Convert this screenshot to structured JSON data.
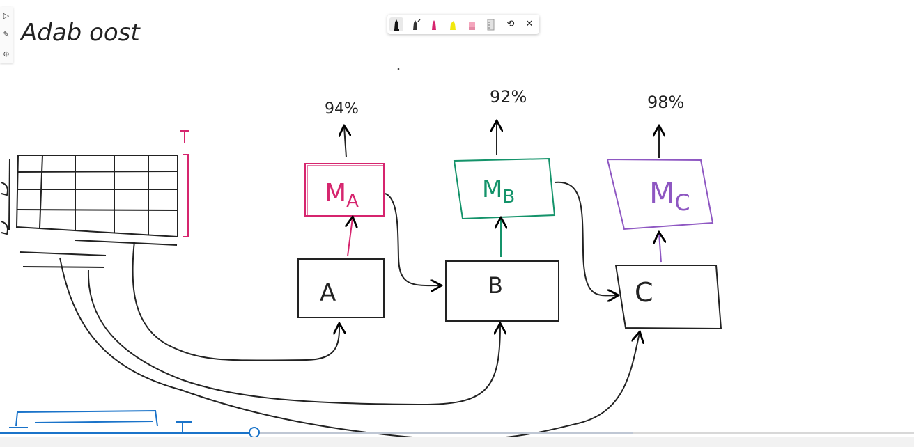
{
  "board": {
    "title": "Adab oost",
    "models": [
      {
        "label": "M",
        "sub": "A",
        "accuracy": "94%",
        "input": "A",
        "color": "#d6256e"
      },
      {
        "label": "M",
        "sub": "B",
        "accuracy": "92%",
        "input": "B",
        "color": "#14936a"
      },
      {
        "label": "M",
        "sub": "C",
        "accuracy": "98%",
        "input": "C",
        "color": "#8e57c2"
      }
    ],
    "dataset_rows_label": "T"
  },
  "toolbar": {
    "left": [
      "pointer-icon",
      "pen-icon",
      "add-icon"
    ],
    "pens": [
      "black-pen",
      "black-pen-2",
      "pink-pen",
      "yellow-highlighter",
      "pink-eraser",
      "ruler"
    ],
    "extras": [
      "lasso-icon",
      "close-icon"
    ]
  },
  "player": {
    "progress": 0.278,
    "buffered": 0.692
  }
}
